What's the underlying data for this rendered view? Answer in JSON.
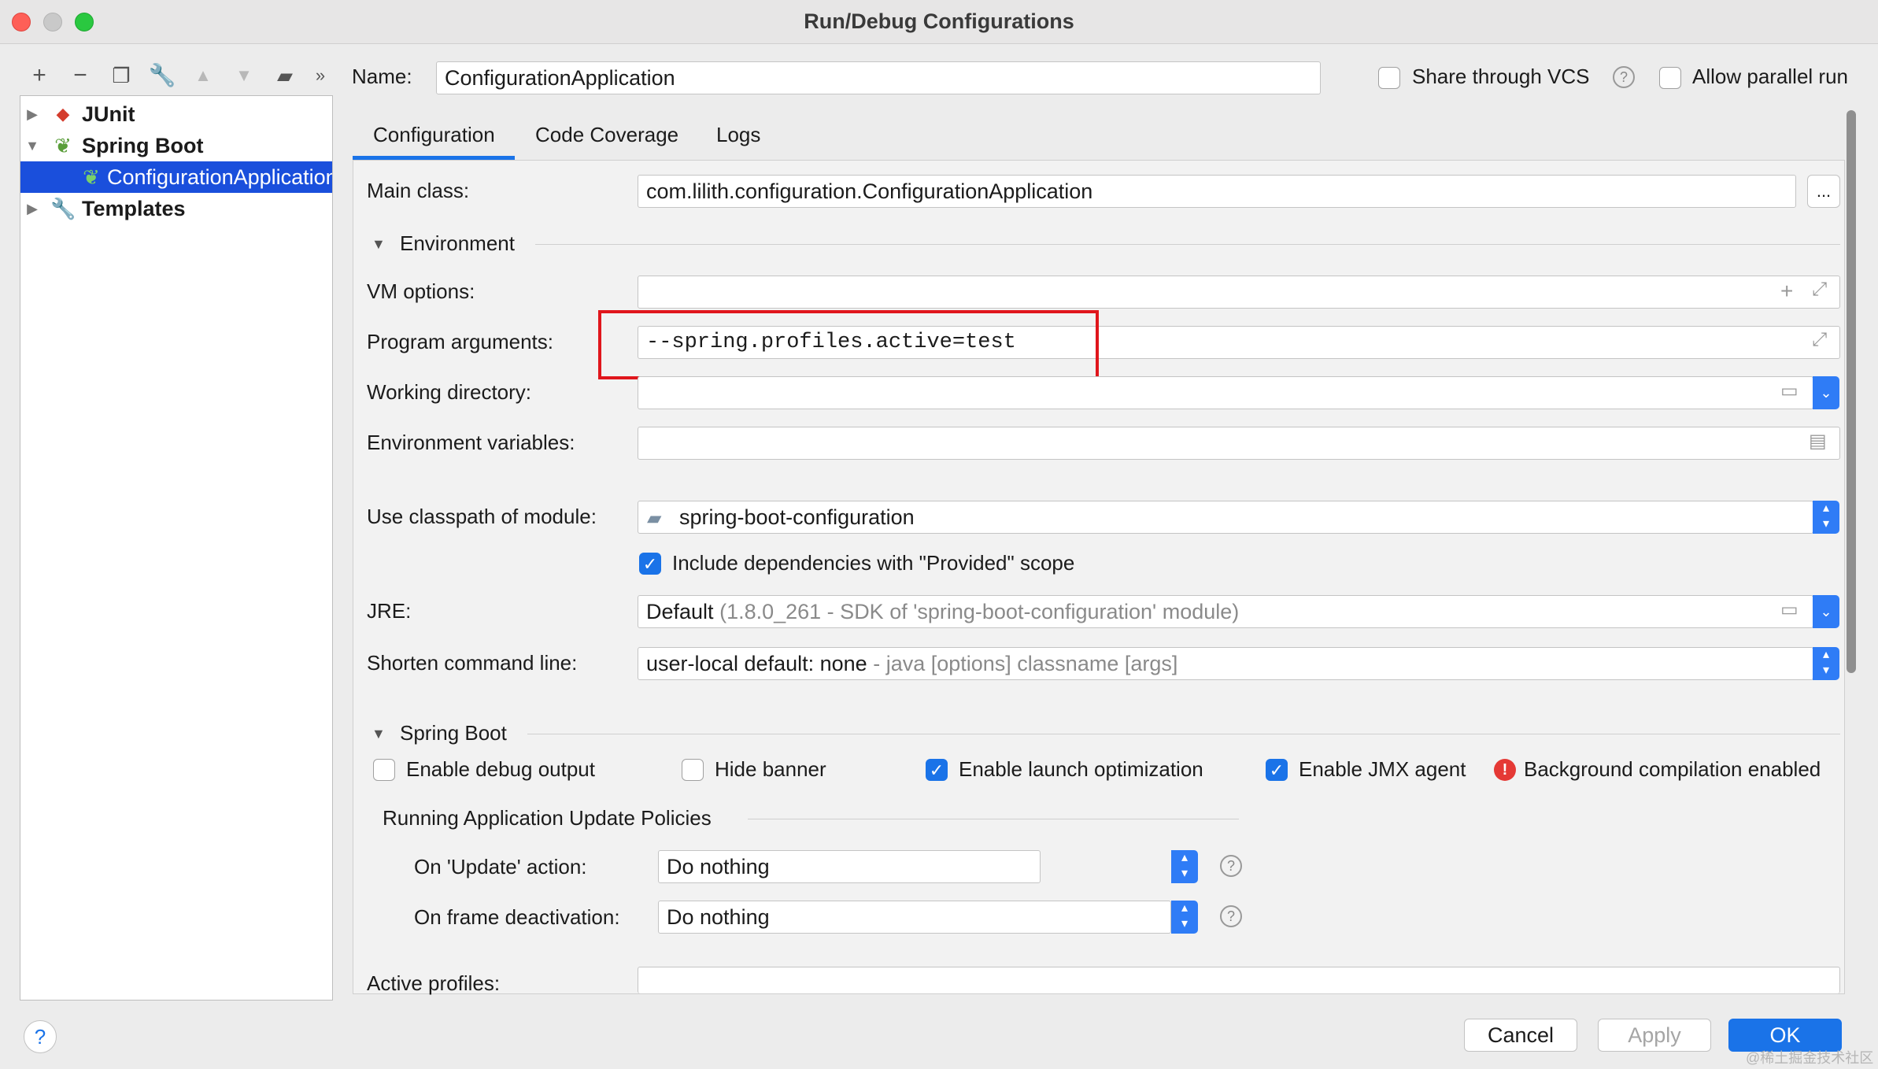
{
  "window": {
    "title": "Run/Debug Configurations"
  },
  "left_toolbar": {
    "icons": [
      "add-icon",
      "remove-icon",
      "copy-icon",
      "wrench-icon",
      "move-up-icon",
      "move-down-icon",
      "folder-add-icon",
      "more-icon"
    ]
  },
  "tree": {
    "items": [
      {
        "label": "JUnit",
        "icon": "junit-icon",
        "expanded": false
      },
      {
        "label": "Spring Boot",
        "icon": "spring-boot-icon",
        "expanded": true
      },
      {
        "label": "ConfigurationApplication",
        "icon": "spring-boot-app-icon",
        "selected": true
      },
      {
        "label": "Templates",
        "icon": "wrench-icon",
        "expanded": false
      }
    ]
  },
  "header": {
    "name_label": "Name:",
    "name_value": "ConfigurationApplication",
    "share_vcs_label": "Share through VCS",
    "share_vcs_checked": false,
    "allow_parallel_label": "Allow parallel run",
    "allow_parallel_checked": false
  },
  "tabs": [
    {
      "label": "Configuration",
      "active": true
    },
    {
      "label": "Code Coverage",
      "active": false
    },
    {
      "label": "Logs",
      "active": false
    }
  ],
  "config": {
    "main_class_label": "Main class:",
    "main_class_value": "com.lilith.configuration.ConfigurationApplication",
    "browse_button": "...",
    "environment_section": "Environment",
    "vm_options_label": "VM options:",
    "vm_options_value": "",
    "program_args_label": "Program arguments:",
    "program_args_value": "--spring.profiles.active=test",
    "working_dir_label": "Working directory:",
    "working_dir_value": "",
    "env_vars_label": "Environment variables:",
    "env_vars_value": "",
    "classpath_label": "Use classpath of module:",
    "classpath_value": "spring-boot-configuration",
    "include_deps_label": "Include dependencies with \"Provided\" scope",
    "include_deps_checked": true,
    "jre_label": "JRE:",
    "jre_value": "Default",
    "jre_detail": "(1.8.0_261 - SDK of 'spring-boot-configuration' module)",
    "shorten_label": "Shorten command line:",
    "shorten_value": "user-local default: none",
    "shorten_detail": "- java [options] classname [args]",
    "spring_boot_section": "Spring Boot",
    "enable_debug_label": "Enable debug output",
    "enable_debug_checked": false,
    "hide_banner_label": "Hide banner",
    "hide_banner_checked": false,
    "launch_opt_label": "Enable launch optimization",
    "launch_opt_checked": true,
    "jmx_label": "Enable JMX agent",
    "jmx_checked": true,
    "bg_compile_label": "Background compilation enabled",
    "update_policies_section": "Running Application Update Policies",
    "on_update_label": "On 'Update' action:",
    "on_update_value": "Do nothing",
    "on_frame_label": "On frame deactivation:",
    "on_frame_value": "Do nothing",
    "active_profiles_label": "Active profiles:",
    "active_profiles_value": ""
  },
  "footer": {
    "cancel": "Cancel",
    "apply": "Apply",
    "ok": "OK",
    "watermark": "@稀土掘金技术社区"
  },
  "colors": {
    "accent": "#1a73e8",
    "selection": "#1a4fdc",
    "highlight_box": "#e0161c",
    "error": "#e53935"
  }
}
